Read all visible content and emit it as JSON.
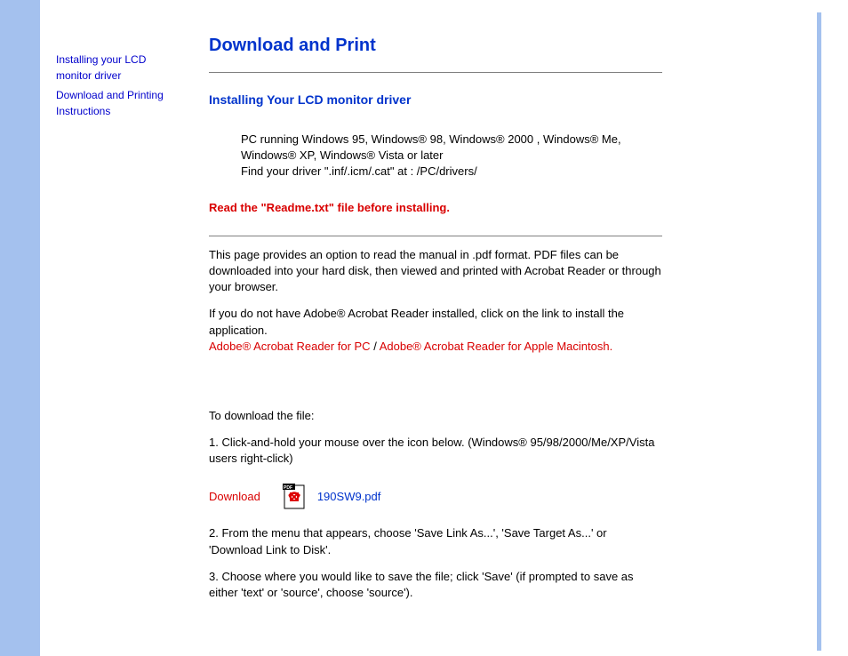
{
  "sidebar": {
    "link1": "Installing your LCD monitor driver",
    "link2": "Download and Printing Instructions"
  },
  "title": "Download and Print",
  "section1_title": "Installing Your LCD monitor driver",
  "req_line1": "PC running Windows 95, Windows® 98, Windows® 2000 , Windows® Me, Windows® XP, Windows® Vista or later",
  "req_line2": "Find your driver \".inf/.icm/.cat\" at : /PC/drivers/",
  "warn_text": "Read the \"Readme.txt\" file before installing.",
  "intro_p1": "This page provides an option to read the manual in .pdf format. PDF files can be downloaded into your hard disk, then viewed and printed with Acrobat Reader or through your browser.",
  "intro_p2_pre": "If you do not have Adobe® Acrobat Reader installed, click on the link to install the application. ",
  "acrobat_pc": "Adobe® Acrobat Reader for PC",
  "sep": " / ",
  "acrobat_mac": "Adobe® Acrobat Reader for Apple Macintosh.",
  "dl_heading": "To download the file:",
  "dl_step1": "1. Click-and-hold your mouse over the icon below. (Windows® 95/98/2000/Me/XP/Vista users right-click)",
  "download_label": "Download",
  "pdf_name": "190SW9.pdf",
  "dl_step2": "2. From the menu that appears, choose 'Save Link As...', 'Save Target As...' or 'Download Link to Disk'.",
  "dl_step3": "3. Choose where you would like to save the file; click 'Save' (if prompted to save as either 'text' or 'source', choose 'source')."
}
